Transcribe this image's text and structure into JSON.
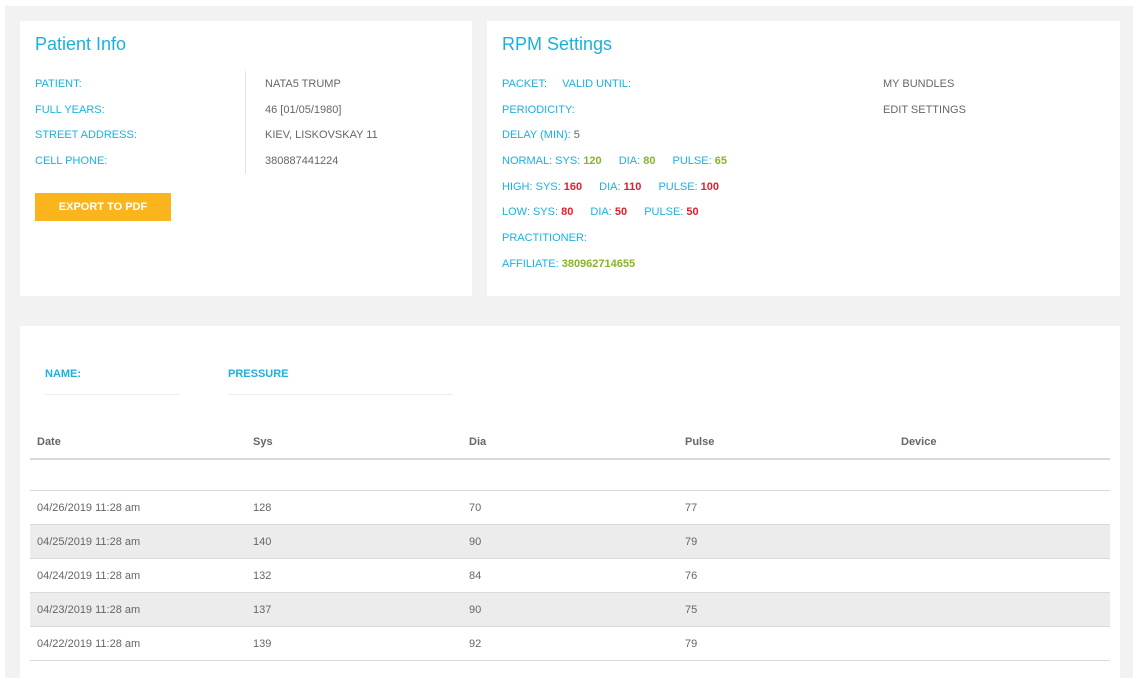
{
  "patient": {
    "title": "Patient Info",
    "fields": [
      {
        "label": "PATIENT:",
        "value": "NATA5 TRUMP"
      },
      {
        "label": "FULL YEARS:",
        "value": "46 [01/05/1980]"
      },
      {
        "label": "STREET ADDRESS:",
        "value": "KIEV, LISKOVSKAY 11"
      },
      {
        "label": "CELL PHONE:",
        "value": "380887441224"
      }
    ],
    "export_label": "EXPORT TO PDF"
  },
  "rpm": {
    "title": "RPM Settings",
    "packet_label": "PACKET:",
    "valid_until_label": "VALID UNTIL:",
    "periodicity_label": "PERIODICITY:",
    "delay_label": "DELAY (MIN):",
    "delay_value": "5",
    "normal": {
      "prefix": "NORMAL: SYS:",
      "sys": "120",
      "dia_label": "DIA:",
      "dia": "80",
      "pulse_label": "PULSE:",
      "pulse": "65"
    },
    "high": {
      "prefix": "HIGH: SYS:",
      "sys": "160",
      "dia_label": "DIA:",
      "dia": "110",
      "pulse_label": "PULSE:",
      "pulse": "100"
    },
    "low": {
      "prefix": "LOW: SYS:",
      "sys": "80",
      "dia_label": "DIA:",
      "dia": "50",
      "pulse_label": "PULSE:",
      "pulse": "50"
    },
    "practitioner_label": "PRACTITIONER:",
    "affiliate_label": "AFFILIATE:",
    "affiliate_value": "380962714655",
    "my_bundles": "MY BUNDLES",
    "edit_settings": "EDIT SETTINGS"
  },
  "filters": {
    "name_label": "NAME:",
    "pressure_label": "PRESSURE"
  },
  "table": {
    "headers": [
      "Date",
      "Sys",
      "Dia",
      "Pulse",
      "Device"
    ],
    "rows": [
      {
        "date": "04/26/2019 11:28 am",
        "sys": "128",
        "dia": "70",
        "pulse": "77",
        "device": ""
      },
      {
        "date": "04/25/2019 11:28 am",
        "sys": "140",
        "dia": "90",
        "pulse": "79",
        "device": ""
      },
      {
        "date": "04/24/2019 11:28 am",
        "sys": "132",
        "dia": "84",
        "pulse": "76",
        "device": ""
      },
      {
        "date": "04/23/2019 11:28 am",
        "sys": "137",
        "dia": "90",
        "pulse": "75",
        "device": ""
      },
      {
        "date": "04/22/2019 11:28 am",
        "sys": "139",
        "dia": "92",
        "pulse": "79",
        "device": ""
      }
    ]
  },
  "colors": {
    "accent": "#1ab1e0",
    "button": "#fbb51c",
    "good": "#86b527",
    "alert": "#e01f2d"
  }
}
